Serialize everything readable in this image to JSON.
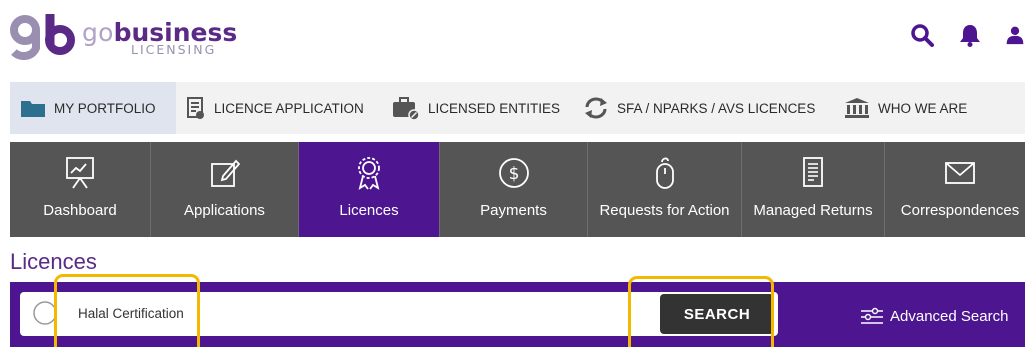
{
  "brand": {
    "go": "go",
    "business": "business",
    "sub": "LICENSING"
  },
  "header_icons": [
    "search-icon",
    "bell-icon",
    "user-icon"
  ],
  "topnav": [
    {
      "label": "MY PORTFOLIO",
      "icon": "folder-icon"
    },
    {
      "label": "LICENCE APPLICATION",
      "icon": "document-icon"
    },
    {
      "label": "LICENSED ENTITIES",
      "icon": "briefcase-icon"
    },
    {
      "label": "SFA / NPARKS / AVS LICENCES",
      "icon": "exchange-icon"
    },
    {
      "label": "WHO WE ARE",
      "icon": "institution-icon"
    }
  ],
  "tiles": [
    {
      "label": "Dashboard",
      "icon": "presentation-icon"
    },
    {
      "label": "Applications",
      "icon": "edit-icon"
    },
    {
      "label": "Licences",
      "icon": "award-icon"
    },
    {
      "label": "Payments",
      "icon": "dollar-icon"
    },
    {
      "label": "Requests for Action",
      "icon": "mouse-icon"
    },
    {
      "label": "Managed Returns",
      "icon": "document-lines-icon"
    },
    {
      "label": "Correspondences",
      "icon": "envelope-icon"
    }
  ],
  "page_title": "Licences",
  "search": {
    "value": "Halal Certification",
    "button": "SEARCH",
    "advanced": "Advanced Search"
  },
  "colors": {
    "purple": "#4d1590",
    "tile_bg": "#555555",
    "highlight": "#f5b800"
  }
}
